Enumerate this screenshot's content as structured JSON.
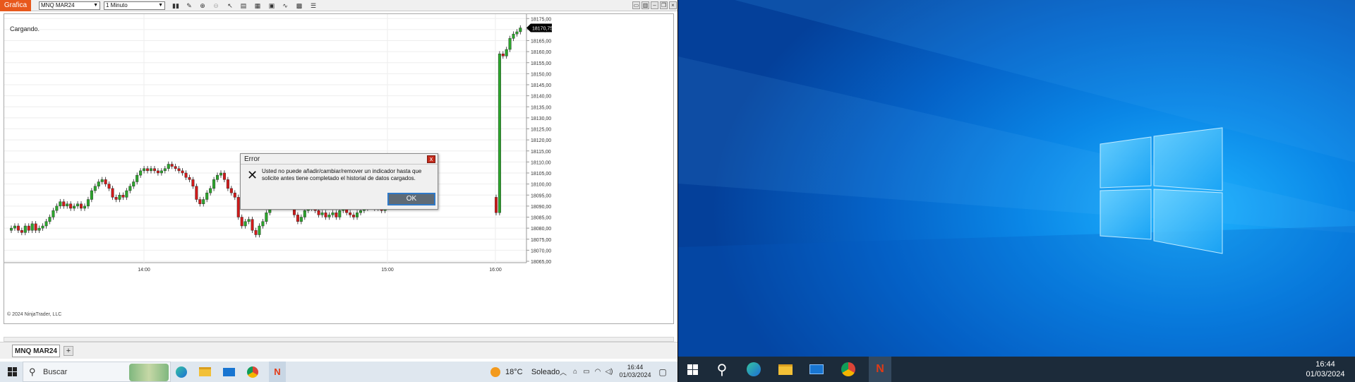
{
  "chart_window": {
    "tab_label": "Grafica",
    "instrument": "MNQ MAR24",
    "interval": "1 Minuto",
    "status_text": "Cargando.",
    "copyright": "© 2024 NinjaTrader, LLC",
    "current_price_label": "18170,75",
    "instrument_tab": "MNQ MAR24",
    "add_tab": "+"
  },
  "dialog": {
    "title": "Error",
    "message": "Usted no puede añadir/cambiar/remover un indicador hasta que solicite antes  tiene completado el historial de datos cargados.",
    "ok_label": "OK",
    "close_label": "x"
  },
  "taskbar_left": {
    "search_label": "Buscar",
    "weather_temp": "18°C",
    "weather_desc": "Soleado",
    "time": "16:44",
    "date": "01/03/2024"
  },
  "taskbar_right": {
    "time": "16:44",
    "date": "01/03/2024"
  },
  "colors": {
    "up_candle": "#2ca52c",
    "down_candle": "#d11a1a",
    "accent_tab": "#e8581c",
    "price_marker": "#000000"
  },
  "chart_data": {
    "type": "candlestick",
    "y_ticks": [
      "18175,00",
      "18170,00",
      "18165,00",
      "18160,00",
      "18155,00",
      "18150,00",
      "18145,00",
      "18140,00",
      "18135,00",
      "18130,00",
      "18125,00",
      "18120,00",
      "18115,00",
      "18110,00",
      "18105,00",
      "18100,00",
      "18095,00",
      "18090,00",
      "18085,00",
      "18080,00",
      "18075,00",
      "18070,00",
      "18065,00"
    ],
    "x_ticks": [
      "14:00",
      "15:00",
      "16:00"
    ],
    "ylim": [
      18065,
      18177
    ],
    "grid": true,
    "closes": [
      18080,
      18081,
      18079,
      18078,
      18081,
      18079,
      18082,
      18079,
      18080,
      18081,
      18083,
      18085,
      18088,
      18090,
      18092,
      18090,
      18091,
      18089,
      18090,
      18091,
      18089,
      18090,
      18093,
      18097,
      18099,
      18101,
      18102,
      18100,
      18098,
      18094,
      18093,
      18095,
      18094,
      18097,
      18099,
      18101,
      18104,
      18106,
      18107,
      18106,
      18107,
      18106,
      18105,
      18106,
      18107,
      18109,
      18108,
      18107,
      18106,
      18105,
      18103,
      18102,
      18099,
      18093,
      18091,
      18093,
      18096,
      18098,
      18102,
      18104,
      18105,
      18102,
      18098,
      18096,
      18094,
      18085,
      18081,
      18083,
      18084,
      18079,
      18077,
      18081,
      18083,
      18087,
      18090,
      18095,
      18097,
      18097,
      18096,
      18095,
      18091,
      18086,
      18083,
      18085,
      18088,
      18089,
      18090,
      18088,
      18086,
      18087,
      18085,
      18086,
      18087,
      18085,
      18088,
      18090,
      18087,
      18086,
      18085,
      18087,
      18088,
      18089,
      18090,
      18091,
      18089,
      18090,
      18088,
      18090,
      18094,
      18094,
      18087,
      18159,
      18158,
      18161,
      18166,
      18168,
      18169,
      18170.75
    ]
  }
}
